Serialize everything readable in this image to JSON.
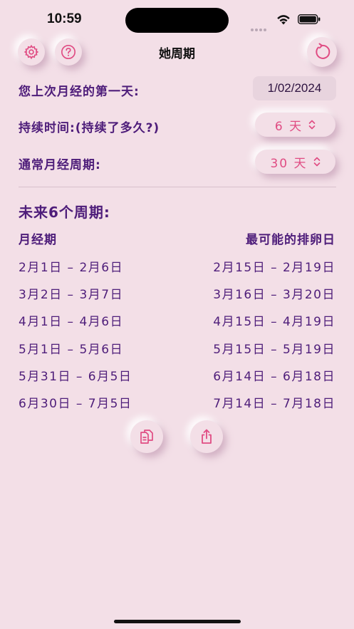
{
  "status_bar": {
    "time": "10:59"
  },
  "nav": {
    "title": "她周期"
  },
  "form": {
    "last_period_label": "您上次月经的第一天:",
    "last_period_value": "1/02/2024",
    "duration_label": "持续时间:(持续了多久?)",
    "duration_value": "6 天",
    "cycle_label": "通常月经周期:",
    "cycle_value": "30 天"
  },
  "forecast": {
    "title": "未来6个周期:",
    "col_period": "月经期",
    "col_ovulation": "最可能的排卵日",
    "rows": [
      {
        "period": "2月1日 – 2月6日",
        "ovulation": "2月15日 – 2月19日"
      },
      {
        "period": "3月2日 – 3月7日",
        "ovulation": "3月16日 – 3月20日"
      },
      {
        "period": "4月1日 – 4月6日",
        "ovulation": "4月15日 – 4月19日"
      },
      {
        "period": "5月1日 – 5月6日",
        "ovulation": "5月15日 – 5月19日"
      },
      {
        "period": "5月31日 – 6月5日",
        "ovulation": "6月14日 – 6月18日"
      },
      {
        "period": "6月30日 – 7月5日",
        "ovulation": "7月14日 – 7月18日"
      }
    ]
  },
  "icons": {
    "settings": "gear-icon",
    "help": "question-circle-icon",
    "reset": "refresh-icon",
    "copy": "copy-icon",
    "share": "share-icon"
  },
  "colors": {
    "background": "#f3dfe7",
    "accent": "#e04c83",
    "text": "#4e1d7a"
  }
}
